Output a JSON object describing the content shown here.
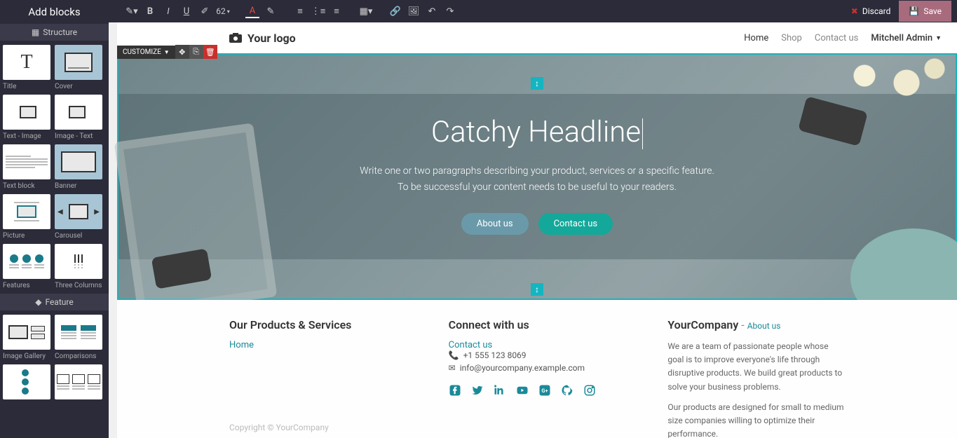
{
  "sidebar": {
    "title": "Add blocks",
    "sections": {
      "structure": "Structure",
      "feature": "Feature"
    },
    "blocks": {
      "title": "Title",
      "cover": "Cover",
      "text_image": "Text - Image",
      "image_text": "Image - Text",
      "text_block": "Text block",
      "banner": "Banner",
      "picture": "Picture",
      "carousel": "Carousel",
      "features": "Features",
      "three_cols": "Three Columns",
      "image_gallery": "Image Gallery",
      "comparisons": "Comparisons"
    }
  },
  "toolbar": {
    "font_size": "62",
    "discard": "Discard",
    "save": "Save"
  },
  "customize": {
    "label": "CUSTOMIZE"
  },
  "header": {
    "logo": "Your logo",
    "nav": {
      "home": "Home",
      "shop": "Shop",
      "contact": "Contact us"
    },
    "admin": "Mitchell Admin"
  },
  "cover": {
    "headline": "Catchy Headline",
    "sub1": "Write one or two paragraphs describing your product, services or a specific feature.",
    "sub2": "To be successful your content needs to be useful to your readers.",
    "about_btn": "About us",
    "contact_btn": "Contact us"
  },
  "footer": {
    "col1": {
      "title": "Our Products & Services",
      "home": "Home"
    },
    "col2": {
      "title": "Connect with us",
      "contact": "Contact us",
      "phone": "+1 555 123 8069",
      "email": "info@yourcompany.example.com"
    },
    "col3": {
      "title": "YourCompany",
      "about": "About us",
      "p1": "We are a team of passionate people whose goal is to improve everyone's life through disruptive products. We build great products to solve your business problems.",
      "p2": "Our products are designed for small to medium size companies willing to optimize their performance."
    },
    "copyright": "Copyright © YourCompany"
  }
}
